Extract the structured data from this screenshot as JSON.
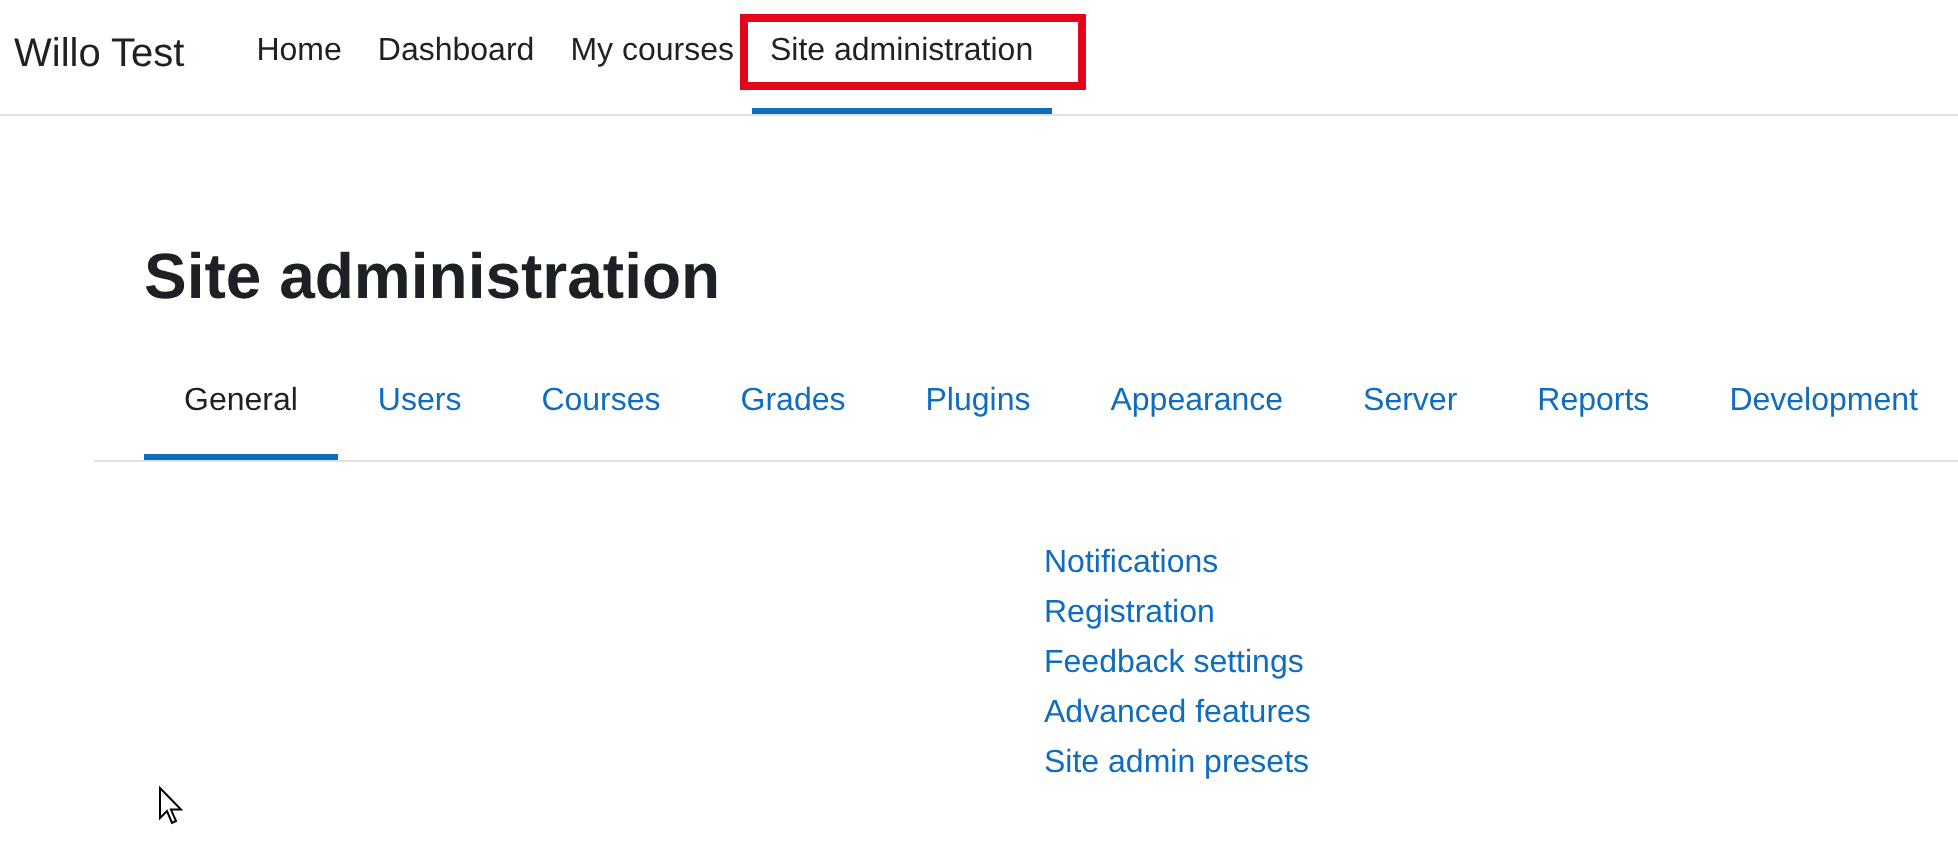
{
  "brand": "Willo Test",
  "nav": [
    {
      "label": "Home",
      "selected": false,
      "highlighted": false
    },
    {
      "label": "Dashboard",
      "selected": false,
      "highlighted": false
    },
    {
      "label": "My courses",
      "selected": false,
      "highlighted": false
    },
    {
      "label": "Site administration",
      "selected": true,
      "highlighted": true
    }
  ],
  "heading": "Site administration",
  "tabs": [
    {
      "label": "General",
      "selected": true
    },
    {
      "label": "Users",
      "selected": false
    },
    {
      "label": "Courses",
      "selected": false
    },
    {
      "label": "Grades",
      "selected": false
    },
    {
      "label": "Plugins",
      "selected": false
    },
    {
      "label": "Appearance",
      "selected": false
    },
    {
      "label": "Server",
      "selected": false
    },
    {
      "label": "Reports",
      "selected": false
    },
    {
      "label": "Development",
      "selected": false
    }
  ],
  "links": [
    "Notifications",
    "Registration",
    "Feedback settings",
    "Advanced features",
    "Site admin presets"
  ]
}
